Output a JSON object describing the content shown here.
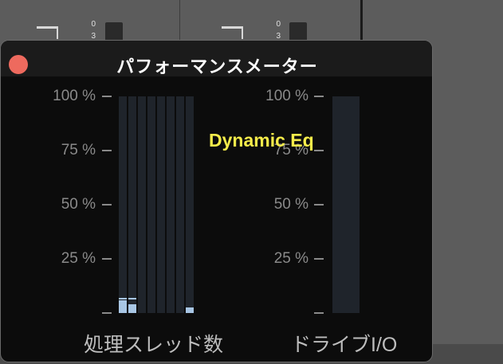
{
  "window": {
    "title": "パフォーマンスメーター"
  },
  "scale": {
    "labels": [
      "100 %",
      "75 %",
      "50 %",
      "25 %"
    ],
    "levels": [
      1.0,
      0.75,
      0.5,
      0.25,
      0.0
    ]
  },
  "threads_meter": {
    "caption": "処理スレッド数",
    "thread_levels": [
      0.06,
      0.04,
      0.0,
      0.0,
      0.0,
      0.0,
      0.0,
      0.025
    ],
    "thread_peaks": [
      0.065,
      0.065,
      null,
      null,
      null,
      null,
      null,
      null
    ]
  },
  "drive_meter": {
    "caption": "ドライブI/O",
    "level": 0.0
  },
  "plugin_label": "Dynamic Eq",
  "background": {
    "scale_top": [
      "0",
      "3"
    ]
  },
  "colors": {
    "close_button": "#ee6a5e",
    "meter_fill": "#a8c6e4",
    "meter_track": "#1f242b",
    "plugin_label": "#f6ec4a"
  }
}
